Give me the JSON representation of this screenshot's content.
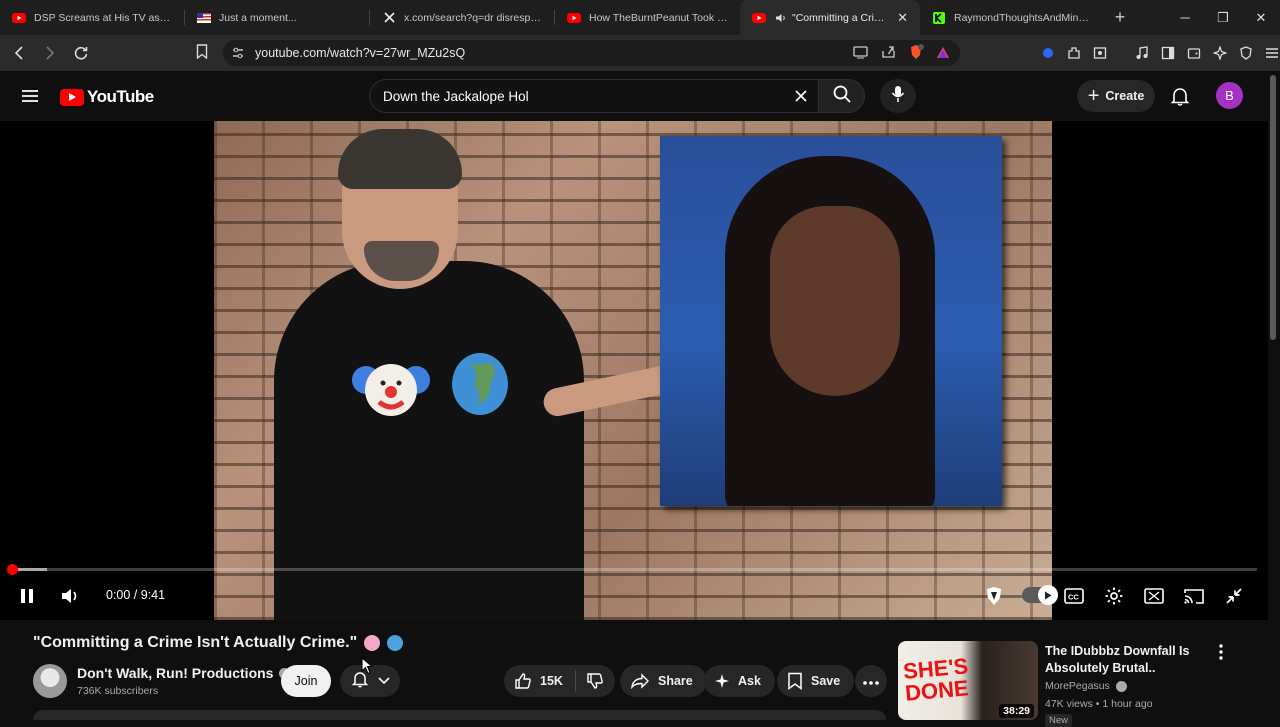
{
  "browser": {
    "tabs": [
      {
        "title": "DSP Screams at His TV as Call of",
        "favicon": "youtube-icon",
        "active": false
      },
      {
        "title": "Just a moment...",
        "favicon": "flag-icon",
        "active": false
      },
      {
        "title": "x.com/search?q=dr disrespect m",
        "favicon": "x-icon",
        "active": false
      },
      {
        "title": "How TheBurntPeanut Took Over",
        "favicon": "youtube-icon",
        "active": false
      },
      {
        "title": "\"Committing a Crime Isn",
        "favicon": "youtube-icon",
        "active": true
      },
      {
        "title": "RaymondThoughtsAndMind Str",
        "favicon": "kick-icon",
        "active": false
      }
    ],
    "url": "youtube.com/watch?v=27wr_MZu2sQ"
  },
  "masthead": {
    "logo_text": "YouTube",
    "search_value": "Down the Jackalope Hol",
    "create_label": "Create",
    "avatar_letter": "B"
  },
  "player": {
    "time_display": "0:00 / 9:41",
    "played_fraction": 0.0,
    "buffered_fraction": 0.028,
    "autoplay_on": true
  },
  "video": {
    "title": "\"Committing a Crime Isn't Actually Crime.\"",
    "channel_name": "Don't Walk, Run! Productions",
    "subscribers": "736K subscribers",
    "join_label": "Join",
    "like_count": "15K",
    "share_label": "Share",
    "ask_label": "Ask",
    "save_label": "Save"
  },
  "recommendation": {
    "thumb_text": "SHE'S DONE",
    "duration": "38:29",
    "title": "The IDubbbz Downfall Is Absolutely Brutal..",
    "channel": "MorePegasus",
    "meta": "47K views • 1 hour ago",
    "badge": "New"
  },
  "colors": {
    "accent": "#ff0000",
    "background": "#0f0f0f",
    "chip": "#272727",
    "avatar": "#a431c4"
  }
}
